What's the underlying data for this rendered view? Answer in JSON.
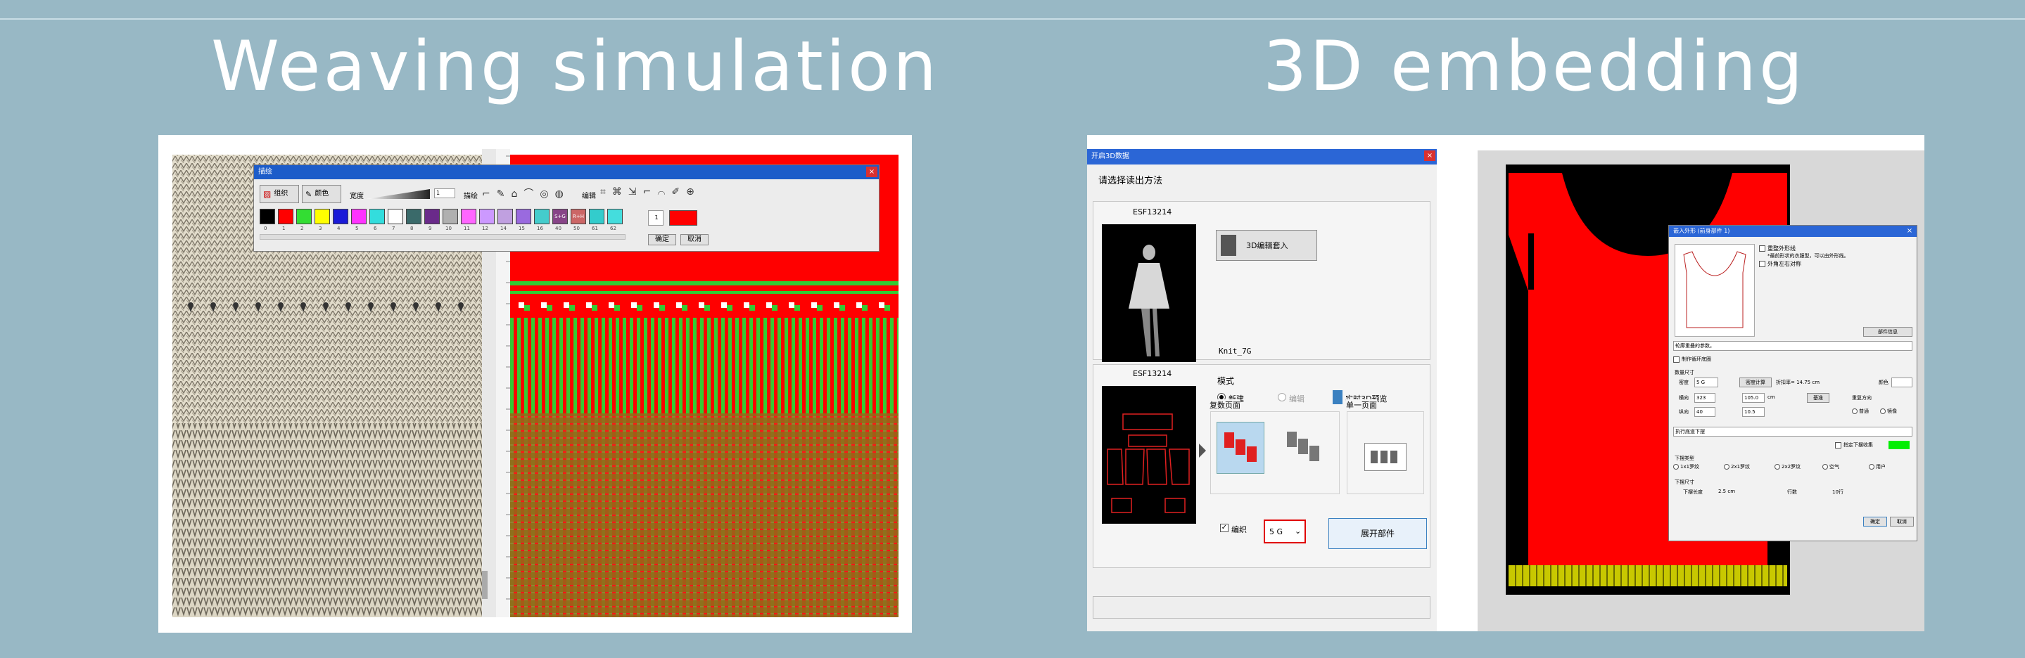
{
  "slide": {
    "left_title": "Weaving simulation",
    "right_title": "3D embedding"
  },
  "weave_panel": {
    "dialog": {
      "title": "描绘",
      "close": "×",
      "tools": [
        "组织",
        "颜色"
      ],
      "width_label": "宽度",
      "width_value": "1",
      "draw_label": "描绘",
      "edit_label": "编辑",
      "swatch_numbers": [
        "0",
        "1",
        "2",
        "3",
        "4",
        "5",
        "6",
        "7",
        "8",
        "9",
        "10",
        "11",
        "12",
        "14",
        "15",
        "16",
        "40",
        "50",
        "61",
        "62"
      ],
      "swatch_text": {
        "40": "S+G",
        "50": "R+H"
      },
      "color_index": "1",
      "color_value": "#ff0000",
      "ok": "确定",
      "cancel": "取消"
    },
    "colors": {
      "red": "#ff0000",
      "green": "#33cc33",
      "knit_bg": "#d8d2c0"
    }
  },
  "load3d_dialog": {
    "title": "开启3D数据",
    "close": "×",
    "prompt": "请选择读出方法",
    "item1": {
      "code": "ESF13214",
      "button": "3D编辑套入",
      "caption": "Knit_7G"
    },
    "item2": {
      "code": "ESF13214"
    },
    "mode": {
      "label": "模式",
      "new": "新建",
      "edit": "编辑",
      "preview": "实时3D预览"
    },
    "multi_page": "复数页面",
    "single_page": "单一页面",
    "knit_checkbox": "编织",
    "gauge": "5 G",
    "expand_button": "展开部件"
  },
  "embed_panel": {
    "dialog": {
      "title": "嵌入外形 (前身部件 1)",
      "close": "×",
      "opt_mirror": "重整外形线",
      "opt_mirror_sub": "*最前形状的衣服型，可以由外形线。",
      "opt_sym": "外角左右对称",
      "detail_btn": "部件信息",
      "section1": "轮廓重叠的参数。",
      "chk_outline": "制作循环底圈",
      "section_size": "数量尺寸",
      "gauge_label": "密度",
      "gauge_value": "5 G",
      "calc_btn": "密度计算",
      "reduce_note": "折扣率= 14.75 cm",
      "color_label": "颜色",
      "width_label": "横向",
      "width_value": "323",
      "width_cm": "105.0",
      "width_unit": "cm",
      "height_label": "纵向",
      "height_value": "40",
      "height_cm": "10.5",
      "scale_btn": "基准",
      "order_label": "重复方向",
      "order_normal": "普通",
      "order_mirror": "镜像",
      "section_bottom": "执行底道下摆",
      "chk_bottom": "指定下摆收集",
      "bottom_color": "#00ee00",
      "hem_label": "下摆类型",
      "hem_opts": [
        "1x1罗纹",
        "2x1罗纹",
        "2x2罗纹",
        "空气",
        "用户"
      ],
      "hem_size_label": "下摆尺寸",
      "hem_length_label": "下摆长度",
      "hem_length_value": "2.5 cm",
      "rows_label": "行数",
      "rows_value": "10行",
      "ok": "确定",
      "cancel": "取消"
    },
    "colors": {
      "body": "#ff0000",
      "rib": "#c8c800"
    }
  }
}
